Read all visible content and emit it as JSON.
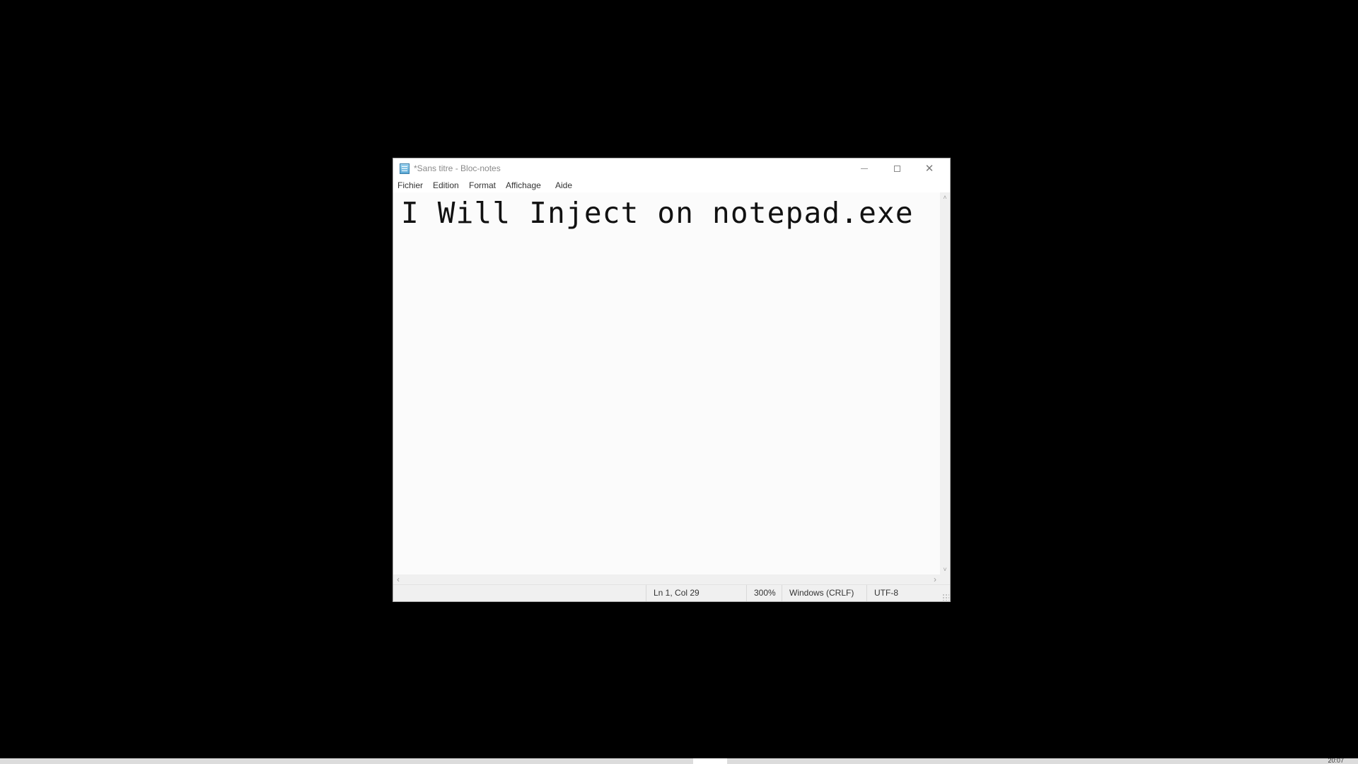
{
  "window": {
    "title": "*Sans titre - Bloc-notes",
    "icon": "notepad-icon",
    "controls": {
      "minimize_icon": "minimize-icon",
      "maximize_icon": "maximize-icon",
      "close_icon": "close-icon",
      "close_glyph": "✕"
    }
  },
  "menu": {
    "items": [
      {
        "label": "Fichier"
      },
      {
        "label": "Edition"
      },
      {
        "label": "Format"
      },
      {
        "label": "Affichage"
      },
      {
        "label": "Aide"
      }
    ]
  },
  "editor": {
    "content": "I Will Inject on notepad.exe"
  },
  "scrollbars": {
    "up_arrow": "˄",
    "down_arrow": "˅",
    "left_arrow": "‹",
    "right_arrow": "›"
  },
  "status": {
    "position": "Ln 1, Col 29",
    "zoom": "300%",
    "line_endings": "Windows (CRLF)",
    "encoding": "UTF-8"
  },
  "taskbar": {
    "clock": "20:07"
  },
  "colors": {
    "desktop": "#000000",
    "window_bg": "#ffffff",
    "editor_bg": "#fbfbfb",
    "statusbar_bg": "#f0f0f0"
  }
}
